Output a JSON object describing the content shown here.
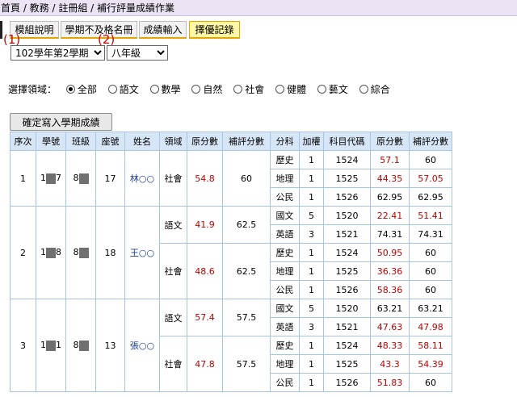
{
  "breadcrumb": "首頁 / 教務 / 註冊組 / 補行評量成績作業",
  "tabs": [
    {
      "label": "模組說明",
      "active": false
    },
    {
      "label": "學期不及格名冊",
      "active": false
    },
    {
      "label": "成績輸入",
      "active": false
    },
    {
      "label": "擇優記錄",
      "active": true
    }
  ],
  "markers": {
    "m1": "(1)",
    "m2": "(2)"
  },
  "semester_select": {
    "value": "102學年第2學期"
  },
  "grade_select": {
    "value": "八年級"
  },
  "domain_filter": {
    "label": "選擇領域：",
    "options": [
      "全部",
      "語文",
      "數學",
      "自然",
      "社會",
      "健體",
      "藝文",
      "綜合"
    ],
    "selected": "全部"
  },
  "write_button": "確定寫入學期成績",
  "table": {
    "headers": [
      "序次",
      "學號",
      "班級",
      "座號",
      "姓名",
      "領域",
      "原分數",
      "補評分數",
      "分科",
      "加權",
      "科目代碼",
      "原分數",
      "補評分數"
    ],
    "students": [
      {
        "seq": "1",
        "id_a": "1",
        "id_b": "7",
        "class_a": "8",
        "seat": "17",
        "name": "林○○",
        "domains": [
          {
            "domain": "社會",
            "orig": "54.8",
            "makeup": "60",
            "subjects": [
              {
                "subject": "歷史",
                "weight": "1",
                "code": "1524",
                "orig": "57.1",
                "makeup": "60",
                "orig_red": true,
                "makeup_red": false
              },
              {
                "subject": "地理",
                "weight": "1",
                "code": "1525",
                "orig": "44.35",
                "makeup": "57.05",
                "orig_red": true,
                "makeup_red": true
              },
              {
                "subject": "公民",
                "weight": "1",
                "code": "1526",
                "orig": "62.95",
                "makeup": "62.95",
                "orig_red": false,
                "makeup_red": false
              }
            ]
          }
        ]
      },
      {
        "seq": "2",
        "id_a": "1",
        "id_b": "8",
        "class_a": "8",
        "seat": "18",
        "name": "王○○",
        "domains": [
          {
            "domain": "語文",
            "orig": "41.9",
            "makeup": "62.5",
            "subjects": [
              {
                "subject": "國文",
                "weight": "5",
                "code": "1520",
                "orig": "22.41",
                "makeup": "51.41",
                "orig_red": true,
                "makeup_red": true
              },
              {
                "subject": "英語",
                "weight": "3",
                "code": "1521",
                "orig": "74.31",
                "makeup": "74.31",
                "orig_red": false,
                "makeup_red": false
              }
            ]
          },
          {
            "domain": "社會",
            "orig": "48.6",
            "makeup": "62.5",
            "subjects": [
              {
                "subject": "歷史",
                "weight": "1",
                "code": "1524",
                "orig": "50.95",
                "makeup": "60",
                "orig_red": true,
                "makeup_red": false
              },
              {
                "subject": "地理",
                "weight": "1",
                "code": "1525",
                "orig": "36.36",
                "makeup": "60",
                "orig_red": true,
                "makeup_red": false
              },
              {
                "subject": "公民",
                "weight": "1",
                "code": "1526",
                "orig": "58.36",
                "makeup": "60",
                "orig_red": true,
                "makeup_red": false
              }
            ]
          }
        ]
      },
      {
        "seq": "3",
        "id_a": "1",
        "id_b": "1",
        "class_a": "8",
        "seat": "13",
        "name": "張○○",
        "domains": [
          {
            "domain": "語文",
            "orig": "57.4",
            "makeup": "57.5",
            "subjects": [
              {
                "subject": "國文",
                "weight": "5",
                "code": "1520",
                "orig": "63.21",
                "makeup": "63.21",
                "orig_red": false,
                "makeup_red": false
              },
              {
                "subject": "英語",
                "weight": "3",
                "code": "1521",
                "orig": "47.63",
                "makeup": "47.98",
                "orig_red": true,
                "makeup_red": true
              }
            ]
          },
          {
            "domain": "社會",
            "orig": "47.8",
            "makeup": "57.5",
            "subjects": [
              {
                "subject": "歷史",
                "weight": "1",
                "code": "1524",
                "orig": "48.33",
                "makeup": "58.11",
                "orig_red": true,
                "makeup_red": true
              },
              {
                "subject": "地理",
                "weight": "1",
                "code": "1525",
                "orig": "43.3",
                "makeup": "54.39",
                "orig_red": true,
                "makeup_red": true
              },
              {
                "subject": "公民",
                "weight": "1",
                "code": "1526",
                "orig": "51.83",
                "makeup": "60",
                "orig_red": true,
                "makeup_red": false
              }
            ]
          }
        ]
      }
    ]
  },
  "colors": {
    "red_score": "#c00000",
    "name_blue": "#1a3c8c",
    "header_bg": "#d7e6f6",
    "active_tab": "#fff7a8",
    "marker_red": "#d00000"
  }
}
